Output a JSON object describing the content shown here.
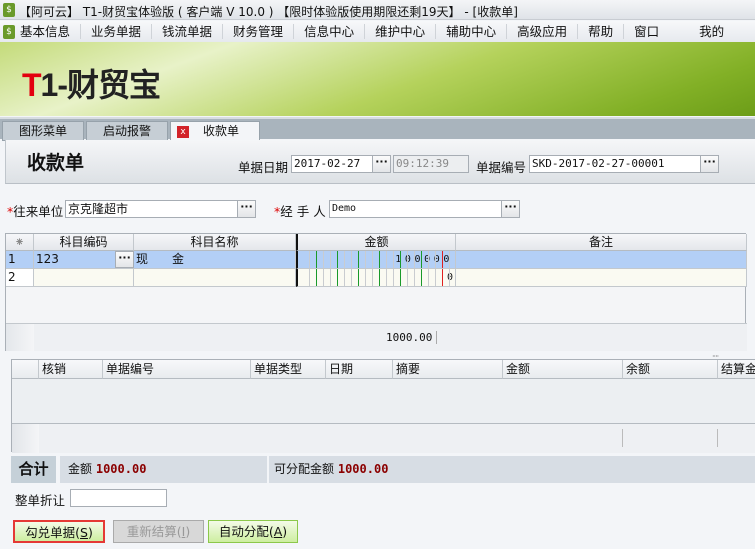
{
  "window": {
    "title": "【阿可云】 T1-财贸宝体验版 ( 客户端 V 10.0 ) 【限时体验版使用期限还剩19天】 - [收款单]"
  },
  "menu": [
    "基本信息",
    "业务单据",
    "钱流单据",
    "财务管理",
    "信息中心",
    "维护中心",
    "辅助中心",
    "高级应用",
    "帮助",
    "窗口",
    "我的"
  ],
  "banner": {
    "logo_red": "T",
    "logo_dark": "1-财贸宝"
  },
  "tabs": [
    "图形菜单",
    "启动报警",
    "收款单"
  ],
  "form": {
    "title": "收款单",
    "date_label": "单据日期",
    "date": "2017-02-27",
    "time": "09:12:39",
    "number_label": "单据编号",
    "number": "SKD-2017-02-27-00001",
    "partner_label": "往来单位",
    "partner": "京克隆超市",
    "handler_label": "经 手 人",
    "handler": "Demo",
    "required_mark": "*"
  },
  "grid": {
    "corner": "⁕",
    "columns": [
      "科目编码",
      "科目名称",
      "金额",
      "备注"
    ],
    "rows": [
      {
        "n": "1",
        "code": "123",
        "name": "现　　金",
        "amount_digits": "100000",
        "note": ""
      },
      {
        "n": "2",
        "code": "",
        "name": "",
        "amount_digits": "0",
        "note": ""
      }
    ],
    "total": "1000.00"
  },
  "settle_grid": {
    "columns": [
      "核销",
      "单据编号",
      "单据类型",
      "日期",
      "摘要",
      "金额",
      "余额",
      "结算金"
    ]
  },
  "totals": {
    "label": "合计",
    "amount_label": "金额",
    "amount": "1000.00",
    "alloc_label": "可分配金额",
    "alloc": "1000.00"
  },
  "discount": {
    "label": "整单折让",
    "value": ""
  },
  "buttons": [
    {
      "label": "勾兑单据(",
      "key": "S",
      "end": ")"
    },
    {
      "label": "重新结算(",
      "key": "I",
      "end": ")"
    },
    {
      "label": "自动分配(",
      "key": "A",
      "end": ")"
    }
  ],
  "colors": {
    "selected_row": "#b3cff6",
    "accent_green": "#7aab1e",
    "amount_red": "#8b0000"
  }
}
